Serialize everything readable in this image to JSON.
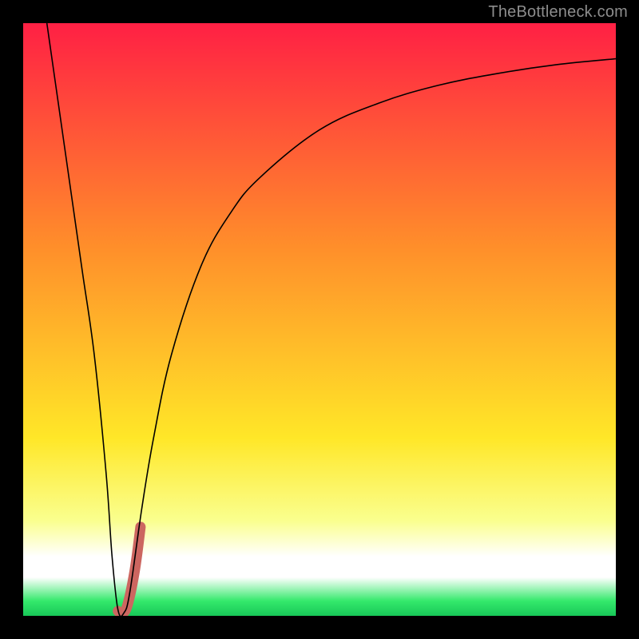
{
  "watermark": "TheBottleneck.com",
  "colors": {
    "gradient_top": "#ff2044",
    "gradient_mid1": "#ff8f2a",
    "gradient_mid2": "#ffe728",
    "gradient_band": "#faff8f",
    "gradient_green": "#34e96b",
    "curve": "#000000",
    "marker": "#cc6660",
    "frame": "#000000"
  },
  "chart_data": {
    "type": "line",
    "title": "",
    "xlabel": "",
    "ylabel": "",
    "xlim": [
      0,
      100
    ],
    "ylim": [
      0,
      100
    ],
    "series": [
      {
        "name": "bottleneck-curve",
        "x": [
          4,
          6,
          8,
          10,
          12,
          14,
          15,
          16,
          17,
          18,
          20,
          22,
          25,
          30,
          35,
          40,
          50,
          60,
          70,
          80,
          90,
          100
        ],
        "values": [
          100,
          86,
          72,
          58,
          44,
          24,
          10,
          1,
          0.5,
          4,
          18,
          30,
          44,
          59,
          68,
          74,
          82,
          86.5,
          89.5,
          91.5,
          93,
          94
        ]
      }
    ],
    "marker": {
      "name": "optimal-region",
      "x": [
        16.0,
        16.5,
        17.5,
        18.8,
        19.8
      ],
      "values": [
        0.8,
        0.5,
        1.5,
        7.5,
        15.0
      ]
    },
    "grid": false,
    "legend": false
  }
}
